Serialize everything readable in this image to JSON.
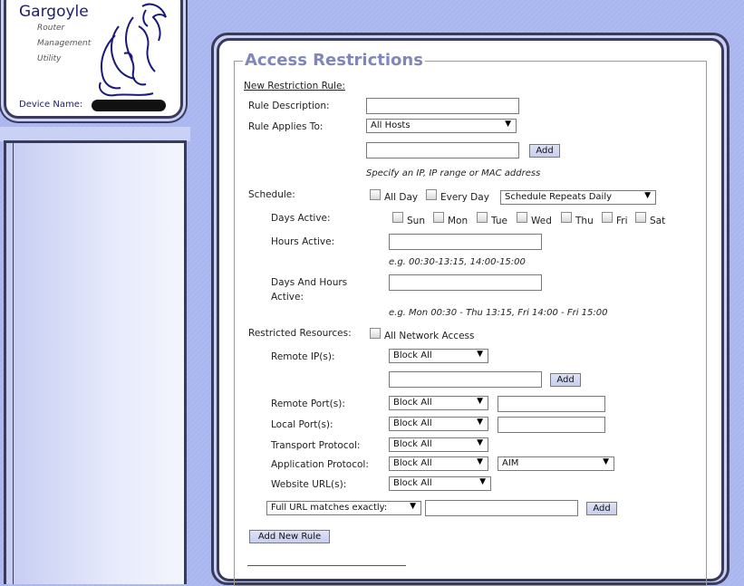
{
  "app": {
    "title": "Gargoyle",
    "subtitle_lines": [
      "Router",
      "Management",
      "Utility"
    ],
    "device_name_label": "Device Name:"
  },
  "section": {
    "title": "Access Restrictions",
    "new_rule_heading": "New Restriction Rule:"
  },
  "form": {
    "rule_description": {
      "label": "Rule Description:",
      "value": ""
    },
    "rule_applies_to": {
      "label": "Rule Applies To:",
      "selected": "All Hosts",
      "add_label": "Add",
      "hint": "Specify an IP, IP range or MAC address",
      "value": ""
    },
    "schedule": {
      "label": "Schedule:",
      "all_day_label": "All Day",
      "every_day_label": "Every Day",
      "repeat_selected": "Schedule Repeats Daily",
      "days_active_label": "Days Active:",
      "days": [
        "Sun",
        "Mon",
        "Tue",
        "Wed",
        "Thu",
        "Fri",
        "Sat"
      ],
      "hours_active_label": "Hours Active:",
      "hours_hint": "e.g. 00:30-13:15, 14:00-15:00",
      "days_hours_label_1": "Days And Hours",
      "days_hours_label_2": "Active:",
      "days_hours_hint": "e.g. Mon 00:30 - Thu 13:15, Fri 14:00 - Fri 15:00"
    },
    "restricted": {
      "label": "Restricted Resources:",
      "all_network_label": "All Network Access",
      "remote_ip_label": "Remote IP(s):",
      "remote_ip_selected": "Block All",
      "remote_ip_add": "Add",
      "remote_port_label": "Remote Port(s):",
      "remote_port_selected": "Block All",
      "local_port_label": "Local Port(s):",
      "local_port_selected": "Block All",
      "transport_label": "Transport Protocol:",
      "transport_selected": "Block All",
      "application_label": "Application Protocol:",
      "application_selected": "Block All",
      "application_protocol_selected": "AIM",
      "website_label": "Website URL(s):",
      "website_selected": "Block All",
      "url_match_selected": "Full URL matches exactly:",
      "url_add": "Add"
    },
    "add_new_rule_label": "Add New Rule"
  }
}
